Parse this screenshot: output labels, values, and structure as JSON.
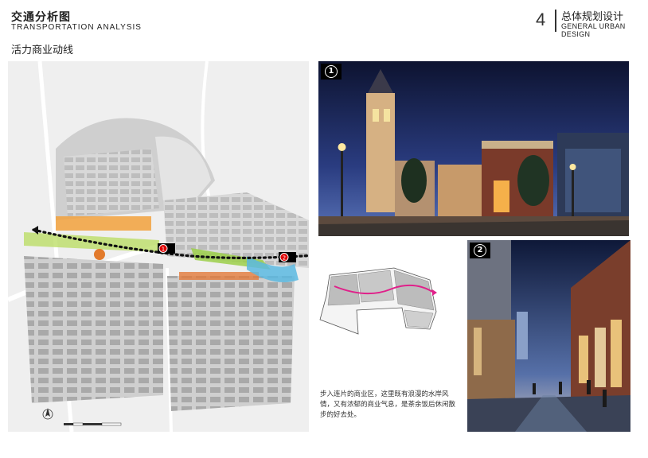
{
  "header": {
    "title_cn": "交通分析图",
    "title_en": "TRANSPORTATION  ANALYSIS",
    "subtitle": "活力商业动线"
  },
  "page": {
    "number": "4",
    "section_cn": "总体规划设计",
    "section_en": "GENERAL URBAN DESIGN"
  },
  "photos": [
    {
      "badge": "1"
    },
    {
      "badge": "2"
    }
  ],
  "map": {
    "markers": [
      "1",
      "2"
    ],
    "colors": {
      "route": "#111111",
      "commercial": "#f2a13c",
      "green": "#9ccf4a",
      "water": "#5bb8e0"
    }
  },
  "caption": "步入连片的商业区，这里既有浪漫的水岸风情，又有浓郁的商业气息，是茶余饭后休闲散步的好去处。",
  "colors": {
    "route_highlight": "#e0208a"
  }
}
